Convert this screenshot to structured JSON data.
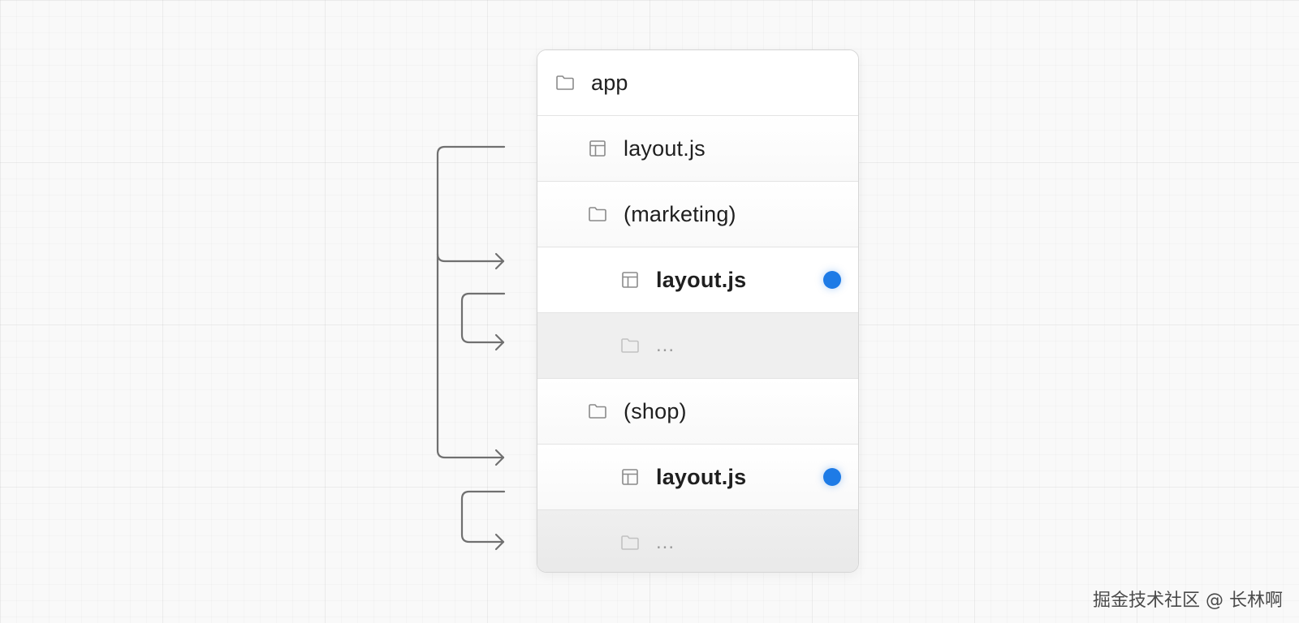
{
  "tree": {
    "rows": [
      {
        "label": "app",
        "icon": "folder-icon",
        "depth": 0,
        "bold": false
      },
      {
        "label": "layout.js",
        "icon": "layout-file-icon",
        "depth": 1,
        "bold": false
      },
      {
        "label": "(marketing)",
        "icon": "folder-icon",
        "depth": 1,
        "bold": false
      },
      {
        "label": "layout.js",
        "icon": "layout-file-icon",
        "depth": 2,
        "bold": true,
        "marked": true
      },
      {
        "label": "...",
        "icon": "folder-icon",
        "depth": 2,
        "muted": true
      },
      {
        "label": "(shop)",
        "icon": "folder-icon",
        "depth": 1,
        "bold": false
      },
      {
        "label": "layout.js",
        "icon": "layout-file-icon",
        "depth": 2,
        "bold": true,
        "marked": true
      },
      {
        "label": "...",
        "icon": "folder-icon",
        "depth": 2,
        "muted": true
      }
    ]
  },
  "colors": {
    "dot": "#1e7be6",
    "arrow": "#707070",
    "icon": "#8a8a8a",
    "icon_muted": "#c2c2c2"
  },
  "watermark": "掘金技术社区 @ 长林啊"
}
